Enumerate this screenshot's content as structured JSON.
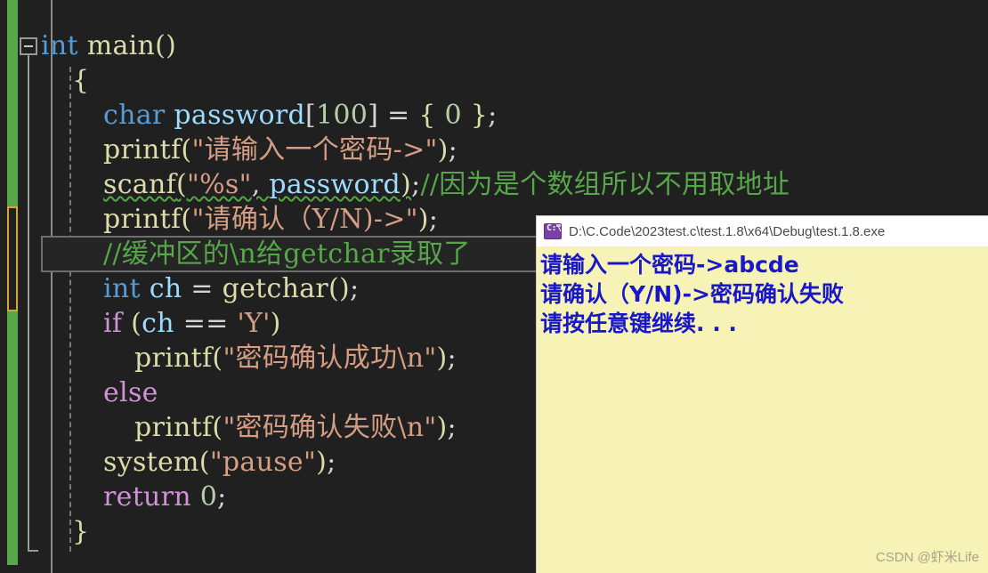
{
  "editor": {
    "theme": "dark",
    "background_color": "#202020",
    "change_bar_saved_color": "#57a64a",
    "change_bar_unsaved_color": "#d8a534",
    "current_line_border_color": "#6e6e6e",
    "collapse_icon": "minus-box-collapse-icon",
    "code_lines": [
      {
        "indent": 0,
        "tokens": [
          {
            "text": "int",
            "cls": "t-kw"
          },
          {
            "text": " ",
            "cls": "t-pun"
          },
          {
            "text": "main",
            "cls": "t-fn"
          },
          {
            "text": "()",
            "cls": "t-brc"
          }
        ]
      },
      {
        "indent": 1,
        "tokens": [
          {
            "text": "{",
            "cls": "t-brc"
          }
        ]
      },
      {
        "indent": 2,
        "tokens": [
          {
            "text": "char",
            "cls": "t-kw"
          },
          {
            "text": " ",
            "cls": "t-pun"
          },
          {
            "text": "password",
            "cls": "t-var"
          },
          {
            "text": "[",
            "cls": "t-pun"
          },
          {
            "text": "100",
            "cls": "t-num"
          },
          {
            "text": "]",
            "cls": "t-pun"
          },
          {
            "text": " = ",
            "cls": "t-pun"
          },
          {
            "text": "{",
            "cls": "t-brc"
          },
          {
            "text": " ",
            "cls": "t-pun"
          },
          {
            "text": "0",
            "cls": "t-num"
          },
          {
            "text": " ",
            "cls": "t-pun"
          },
          {
            "text": "}",
            "cls": "t-brc"
          },
          {
            "text": ";",
            "cls": "t-pun"
          }
        ]
      },
      {
        "indent": 2,
        "tokens": [
          {
            "text": "printf",
            "cls": "t-fn"
          },
          {
            "text": "(",
            "cls": "t-brc"
          },
          {
            "text": "\"请输入一个密码->\"",
            "cls": "t-str"
          },
          {
            "text": ")",
            "cls": "t-brc"
          },
          {
            "text": ";",
            "cls": "t-pun"
          }
        ]
      },
      {
        "indent": 2,
        "squiggle": true,
        "tokens": [
          {
            "text": "scanf",
            "cls": "t-fn"
          },
          {
            "text": "(",
            "cls": "t-brc"
          },
          {
            "text": "\"%s\"",
            "cls": "t-str"
          },
          {
            "text": ", ",
            "cls": "t-pun"
          },
          {
            "text": "password",
            "cls": "t-var"
          },
          {
            "text": ")",
            "cls": "t-brc"
          },
          {
            "text": ";",
            "cls": "t-pun",
            "nosquig": true
          },
          {
            "text": "//因为是个数组所以不用取地址",
            "cls": "t-cmt",
            "nosquig": true
          }
        ]
      },
      {
        "indent": 2,
        "tokens": [
          {
            "text": "printf",
            "cls": "t-fn"
          },
          {
            "text": "(",
            "cls": "t-brc"
          },
          {
            "text": "\"请确认（Y/N)->\"",
            "cls": "t-str"
          },
          {
            "text": ")",
            "cls": "t-brc"
          },
          {
            "text": ";",
            "cls": "t-pun"
          }
        ]
      },
      {
        "indent": 2,
        "current": true,
        "tokens": [
          {
            "text": "//缓冲区的\\n给getchar录取了",
            "cls": "t-cmt"
          }
        ]
      },
      {
        "indent": 2,
        "tokens": [
          {
            "text": "int",
            "cls": "t-kw"
          },
          {
            "text": " ",
            "cls": "t-pun"
          },
          {
            "text": "ch",
            "cls": "t-var"
          },
          {
            "text": " = ",
            "cls": "t-pun"
          },
          {
            "text": "getchar",
            "cls": "t-fn"
          },
          {
            "text": "()",
            "cls": "t-brc"
          },
          {
            "text": ";",
            "cls": "t-pun"
          }
        ]
      },
      {
        "indent": 2,
        "tokens": [
          {
            "text": "if",
            "cls": "t-kw2"
          },
          {
            "text": " ",
            "cls": "t-pun"
          },
          {
            "text": "(",
            "cls": "t-brc"
          },
          {
            "text": "ch",
            "cls": "t-var"
          },
          {
            "text": " == ",
            "cls": "t-pun"
          },
          {
            "text": "'Y'",
            "cls": "t-str"
          },
          {
            "text": ")",
            "cls": "t-brc"
          }
        ]
      },
      {
        "indent": 3,
        "tokens": [
          {
            "text": "printf",
            "cls": "t-fn"
          },
          {
            "text": "(",
            "cls": "t-brc"
          },
          {
            "text": "\"密码确认成功\\n\"",
            "cls": "t-str"
          },
          {
            "text": ")",
            "cls": "t-brc"
          },
          {
            "text": ";",
            "cls": "t-pun"
          }
        ]
      },
      {
        "indent": 2,
        "tokens": [
          {
            "text": "else",
            "cls": "t-kw2"
          }
        ]
      },
      {
        "indent": 3,
        "tokens": [
          {
            "text": "printf",
            "cls": "t-fn"
          },
          {
            "text": "(",
            "cls": "t-brc"
          },
          {
            "text": "\"密码确认失败\\n\"",
            "cls": "t-str"
          },
          {
            "text": ")",
            "cls": "t-brc"
          },
          {
            "text": ";",
            "cls": "t-pun"
          }
        ]
      },
      {
        "indent": 2,
        "tokens": [
          {
            "text": "system",
            "cls": "t-fn"
          },
          {
            "text": "(",
            "cls": "t-brc"
          },
          {
            "text": "\"pause\"",
            "cls": "t-str"
          },
          {
            "text": ")",
            "cls": "t-brc"
          },
          {
            "text": ";",
            "cls": "t-pun"
          }
        ]
      },
      {
        "indent": 2,
        "tokens": [
          {
            "text": "return",
            "cls": "t-kw2"
          },
          {
            "text": " ",
            "cls": "t-pun"
          },
          {
            "text": "0",
            "cls": "t-num"
          },
          {
            "text": ";",
            "cls": "t-pun"
          }
        ]
      },
      {
        "indent": 1,
        "tokens": [
          {
            "text": "}",
            "cls": "t-brc"
          }
        ]
      }
    ]
  },
  "console": {
    "icon": "console-app-icon",
    "title": "D:\\C.Code\\2023test.c\\test.1.8\\x64\\Debug\\test.1.8.exe",
    "background_color": "#f7f2b5",
    "text_color": "#1818c8",
    "output_lines": [
      "请输入一个密码->abcde",
      "请确认（Y/N)->密码确认失败",
      "请按任意键继续. . ."
    ]
  },
  "watermark": {
    "text": "CSDN @虾米Life"
  }
}
